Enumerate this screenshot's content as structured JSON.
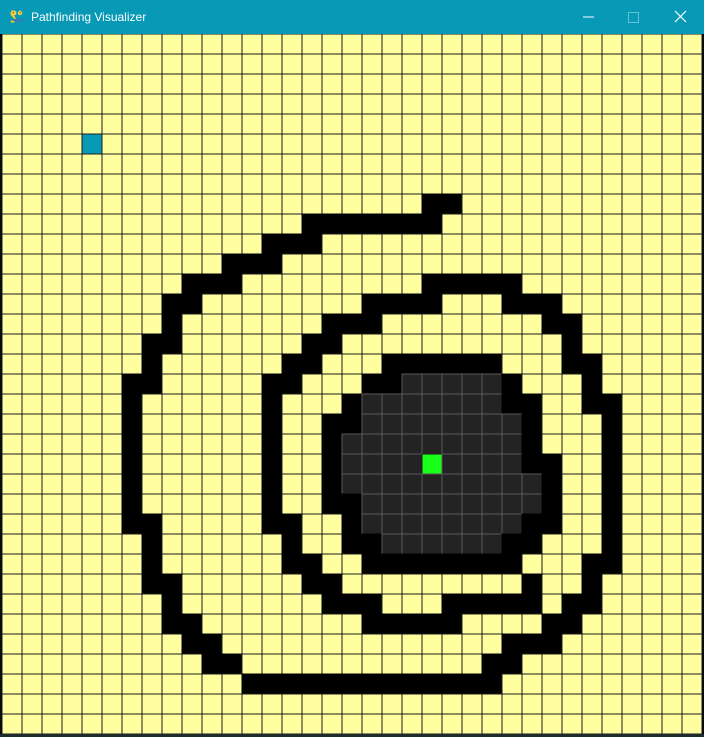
{
  "window": {
    "title": "Pathfinding Visualizer",
    "buttons": {
      "minimize": "minimize",
      "maximize": "maximize",
      "close": "close"
    }
  },
  "grid": {
    "rows": 35,
    "cols": 35,
    "colors": {
      "empty": "#ffff9f",
      "wall": "#000000",
      "visited": "#232323",
      "start": "#0899b7",
      "end": "#18ff18",
      "line": "#1b1b1b",
      "visited_line": "#5a5a5a"
    },
    "start": [
      5,
      4
    ],
    "end": [
      21,
      21
    ],
    "barrier_cells": [
      [
        8,
        21
      ],
      [
        8,
        22
      ],
      [
        9,
        15
      ],
      [
        9,
        16
      ],
      [
        9,
        17
      ],
      [
        9,
        18
      ],
      [
        9,
        19
      ],
      [
        9,
        20
      ],
      [
        9,
        21
      ],
      [
        10,
        13
      ],
      [
        10,
        14
      ],
      [
        10,
        15
      ],
      [
        11,
        11
      ],
      [
        11,
        12
      ],
      [
        11,
        13
      ],
      [
        12,
        9
      ],
      [
        12,
        10
      ],
      [
        12,
        11
      ],
      [
        12,
        21
      ],
      [
        12,
        22
      ],
      [
        12,
        23
      ],
      [
        12,
        24
      ],
      [
        12,
        25
      ],
      [
        13,
        8
      ],
      [
        13,
        9
      ],
      [
        13,
        18
      ],
      [
        13,
        19
      ],
      [
        13,
        20
      ],
      [
        13,
        21
      ],
      [
        13,
        25
      ],
      [
        13,
        26
      ],
      [
        13,
        27
      ],
      [
        14,
        8
      ],
      [
        14,
        16
      ],
      [
        14,
        17
      ],
      [
        14,
        18
      ],
      [
        14,
        27
      ],
      [
        14,
        28
      ],
      [
        15,
        7
      ],
      [
        15,
        8
      ],
      [
        15,
        15
      ],
      [
        15,
        16
      ],
      [
        15,
        28
      ],
      [
        16,
        7
      ],
      [
        16,
        14
      ],
      [
        16,
        15
      ],
      [
        16,
        19
      ],
      [
        16,
        20
      ],
      [
        16,
        21
      ],
      [
        16,
        22
      ],
      [
        16,
        23
      ],
      [
        16,
        24
      ],
      [
        16,
        28
      ],
      [
        16,
        29
      ],
      [
        17,
        6
      ],
      [
        17,
        7
      ],
      [
        17,
        13
      ],
      [
        17,
        14
      ],
      [
        17,
        18
      ],
      [
        17,
        19
      ],
      [
        17,
        25
      ],
      [
        17,
        29
      ],
      [
        18,
        6
      ],
      [
        18,
        13
      ],
      [
        18,
        17
      ],
      [
        18,
        25
      ],
      [
        18,
        26
      ],
      [
        18,
        29
      ],
      [
        18,
        30
      ],
      [
        19,
        6
      ],
      [
        19,
        13
      ],
      [
        19,
        16
      ],
      [
        19,
        17
      ],
      [
        19,
        26
      ],
      [
        19,
        30
      ],
      [
        20,
        6
      ],
      [
        20,
        13
      ],
      [
        20,
        16
      ],
      [
        20,
        26
      ],
      [
        20,
        30
      ],
      [
        21,
        6
      ],
      [
        21,
        13
      ],
      [
        21,
        16
      ],
      [
        21,
        26
      ],
      [
        21,
        27
      ],
      [
        21,
        30
      ],
      [
        22,
        6
      ],
      [
        22,
        13
      ],
      [
        22,
        16
      ],
      [
        22,
        27
      ],
      [
        22,
        30
      ],
      [
        23,
        6
      ],
      [
        23,
        13
      ],
      [
        23,
        16
      ],
      [
        23,
        17
      ],
      [
        23,
        27
      ],
      [
        23,
        30
      ],
      [
        24,
        6
      ],
      [
        24,
        7
      ],
      [
        24,
        13
      ],
      [
        24,
        14
      ],
      [
        24,
        17
      ],
      [
        24,
        26
      ],
      [
        24,
        27
      ],
      [
        24,
        30
      ],
      [
        25,
        7
      ],
      [
        25,
        14
      ],
      [
        25,
        17
      ],
      [
        25,
        18
      ],
      [
        25,
        25
      ],
      [
        25,
        26
      ],
      [
        25,
        30
      ],
      [
        26,
        7
      ],
      [
        26,
        14
      ],
      [
        26,
        15
      ],
      [
        26,
        18
      ],
      [
        26,
        19
      ],
      [
        26,
        20
      ],
      [
        26,
        21
      ],
      [
        26,
        22
      ],
      [
        26,
        23
      ],
      [
        26,
        24
      ],
      [
        26,
        25
      ],
      [
        26,
        29
      ],
      [
        26,
        30
      ],
      [
        27,
        7
      ],
      [
        27,
        8
      ],
      [
        27,
        15
      ],
      [
        27,
        16
      ],
      [
        27,
        26
      ],
      [
        27,
        29
      ],
      [
        28,
        8
      ],
      [
        28,
        16
      ],
      [
        28,
        17
      ],
      [
        28,
        18
      ],
      [
        28,
        22
      ],
      [
        28,
        23
      ],
      [
        28,
        24
      ],
      [
        28,
        25
      ],
      [
        28,
        26
      ],
      [
        28,
        28
      ],
      [
        28,
        29
      ],
      [
        29,
        8
      ],
      [
        29,
        9
      ],
      [
        29,
        18
      ],
      [
        29,
        19
      ],
      [
        29,
        20
      ],
      [
        29,
        21
      ],
      [
        29,
        22
      ],
      [
        29,
        27
      ],
      [
        29,
        28
      ],
      [
        30,
        9
      ],
      [
        30,
        10
      ],
      [
        30,
        25
      ],
      [
        30,
        26
      ],
      [
        30,
        27
      ],
      [
        31,
        10
      ],
      [
        31,
        11
      ],
      [
        31,
        24
      ],
      [
        31,
        25
      ],
      [
        32,
        12
      ],
      [
        32,
        13
      ],
      [
        32,
        14
      ],
      [
        32,
        15
      ],
      [
        32,
        16
      ],
      [
        32,
        17
      ],
      [
        32,
        18
      ],
      [
        32,
        19
      ],
      [
        32,
        20
      ],
      [
        32,
        21
      ],
      [
        32,
        22
      ],
      [
        32,
        23
      ],
      [
        32,
        24
      ]
    ],
    "visited_cells": [
      [
        17,
        20
      ],
      [
        17,
        21
      ],
      [
        17,
        22
      ],
      [
        17,
        23
      ],
      [
        17,
        24
      ],
      [
        18,
        18
      ],
      [
        18,
        19
      ],
      [
        18,
        20
      ],
      [
        18,
        21
      ],
      [
        18,
        22
      ],
      [
        18,
        23
      ],
      [
        18,
        24
      ],
      [
        19,
        18
      ],
      [
        19,
        19
      ],
      [
        19,
        20
      ],
      [
        19,
        21
      ],
      [
        19,
        22
      ],
      [
        19,
        23
      ],
      [
        19,
        24
      ],
      [
        19,
        25
      ],
      [
        20,
        17
      ],
      [
        20,
        18
      ],
      [
        20,
        19
      ],
      [
        20,
        20
      ],
      [
        20,
        21
      ],
      [
        20,
        22
      ],
      [
        20,
        23
      ],
      [
        20,
        24
      ],
      [
        20,
        25
      ],
      [
        21,
        17
      ],
      [
        21,
        18
      ],
      [
        21,
        19
      ],
      [
        21,
        20
      ],
      [
        21,
        22
      ],
      [
        21,
        23
      ],
      [
        21,
        24
      ],
      [
        21,
        25
      ],
      [
        22,
        17
      ],
      [
        22,
        18
      ],
      [
        22,
        19
      ],
      [
        22,
        20
      ],
      [
        22,
        21
      ],
      [
        22,
        22
      ],
      [
        22,
        23
      ],
      [
        22,
        24
      ],
      [
        22,
        25
      ],
      [
        22,
        26
      ],
      [
        23,
        18
      ],
      [
        23,
        19
      ],
      [
        23,
        20
      ],
      [
        23,
        21
      ],
      [
        23,
        22
      ],
      [
        23,
        23
      ],
      [
        23,
        24
      ],
      [
        23,
        25
      ],
      [
        23,
        26
      ],
      [
        24,
        18
      ],
      [
        24,
        19
      ],
      [
        24,
        20
      ],
      [
        24,
        21
      ],
      [
        24,
        22
      ],
      [
        24,
        23
      ],
      [
        24,
        24
      ],
      [
        24,
        25
      ],
      [
        25,
        19
      ],
      [
        25,
        20
      ],
      [
        25,
        21
      ],
      [
        25,
        22
      ],
      [
        25,
        23
      ],
      [
        25,
        24
      ]
    ]
  }
}
